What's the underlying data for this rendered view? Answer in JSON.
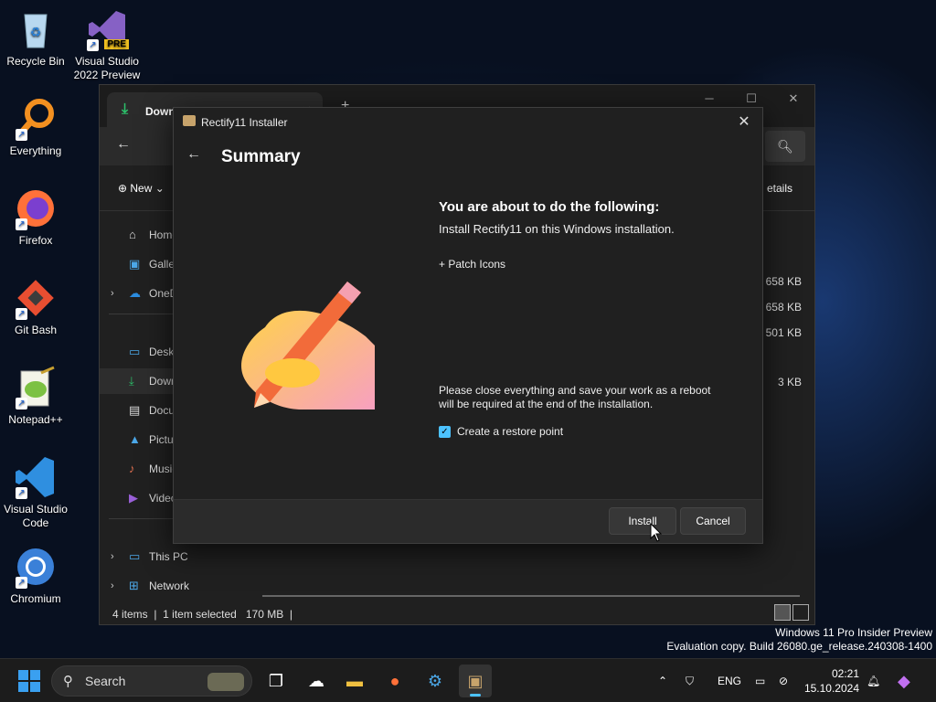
{
  "desktop": {
    "icons": [
      {
        "label": "Recycle Bin"
      },
      {
        "label": "Visual Studio 2022 Preview",
        "badge": "PRE"
      },
      {
        "label": "Everything"
      },
      {
        "label": "Firefox"
      },
      {
        "label": "Git Bash"
      },
      {
        "label": "Notepad++"
      },
      {
        "label": "Visual Studio Code"
      },
      {
        "label": "Chromium"
      }
    ]
  },
  "explorer": {
    "tab_title": "Downloads",
    "toolbar_new": "New",
    "toolbar_details": "etails",
    "nav": [
      {
        "label": "Home"
      },
      {
        "label": "Gallery"
      },
      {
        "label": "OneDrive"
      },
      {
        "label": "Desktop"
      },
      {
        "label": "Downloads"
      },
      {
        "label": "Documents"
      },
      {
        "label": "Pictures"
      },
      {
        "label": "Music"
      },
      {
        "label": "Videos"
      },
      {
        "label": "This PC"
      },
      {
        "label": "Network"
      }
    ],
    "sizes": [
      "658 KB",
      "658 KB",
      "501 KB",
      "3 KB"
    ],
    "status": {
      "items": "4 items",
      "selected": "1 item selected",
      "size": "170 MB"
    }
  },
  "installer": {
    "window_title": "Rectify11 Installer",
    "heading": "Summary",
    "summary_title": "You are about to do the following:",
    "summary_desc": "Install Rectify11 on this Windows installation.",
    "summary_item": "+ Patch Icons",
    "warning": "Please close everything and save your work as a reboot will be required at the end of the installation.",
    "restore_label": "Create a restore point",
    "restore_checked": true,
    "install_label": "Install",
    "cancel_label": "Cancel"
  },
  "watermark": {
    "line1": "Windows 11 Pro Insider Preview",
    "line2": "Evaluation copy. Build 26080.ge_release.240308-1400"
  },
  "taskbar": {
    "search_placeholder": "Search",
    "language": "ENG",
    "time": "02:21",
    "date": "15.10.2024",
    "accent": "#4cc2ff"
  }
}
